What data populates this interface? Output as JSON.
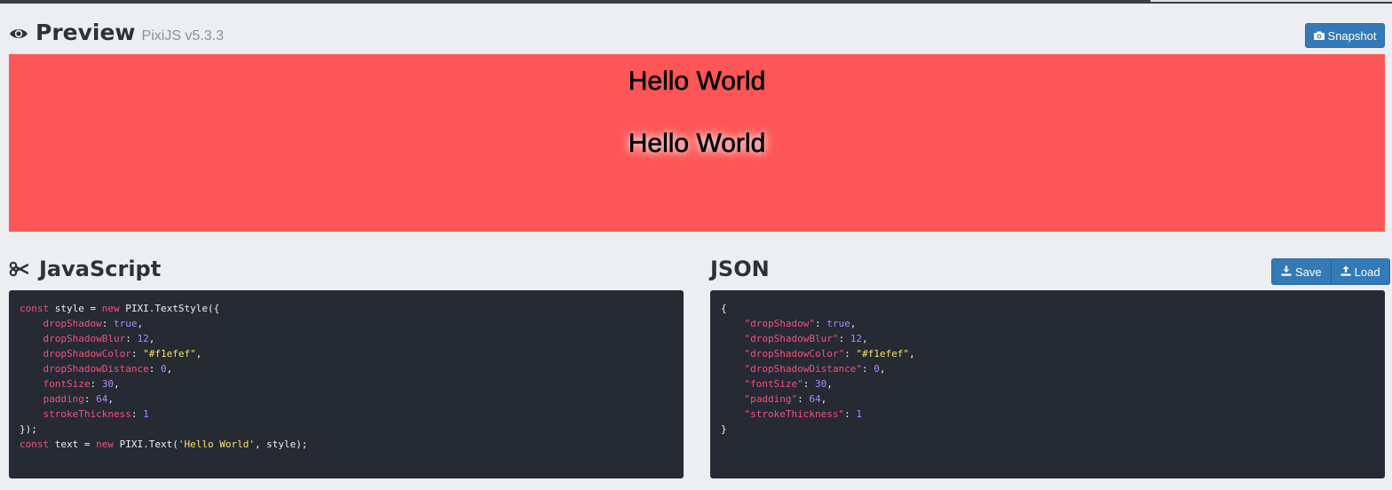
{
  "preview": {
    "title": "Preview",
    "subtitle": "PixiJS v5.3.3",
    "snapshot_label": "Snapshot",
    "canvas_bg": "#fe5656",
    "texts": [
      "Hello World",
      "Hello World"
    ]
  },
  "javascript": {
    "title": "JavaScript",
    "lines": [
      [
        [
          "kw",
          "const"
        ],
        [
          "plain",
          " style = "
        ],
        [
          "kw",
          "new"
        ],
        [
          "plain",
          " PIXI.TextStyle({"
        ]
      ],
      [
        [
          "plain",
          "    "
        ],
        [
          "prop",
          "dropShadow"
        ],
        [
          "plain",
          ": "
        ],
        [
          "bool",
          "true"
        ],
        [
          "plain",
          ","
        ]
      ],
      [
        [
          "plain",
          "    "
        ],
        [
          "prop",
          "dropShadowBlur"
        ],
        [
          "plain",
          ": "
        ],
        [
          "num",
          "12"
        ],
        [
          "plain",
          ","
        ]
      ],
      [
        [
          "plain",
          "    "
        ],
        [
          "prop",
          "dropShadowColor"
        ],
        [
          "plain",
          ": "
        ],
        [
          "str",
          "\"#f1efef\""
        ],
        [
          "plain",
          ","
        ]
      ],
      [
        [
          "plain",
          "    "
        ],
        [
          "prop",
          "dropShadowDistance"
        ],
        [
          "plain",
          ": "
        ],
        [
          "num",
          "0"
        ],
        [
          "plain",
          ","
        ]
      ],
      [
        [
          "plain",
          "    "
        ],
        [
          "prop",
          "fontSize"
        ],
        [
          "plain",
          ": "
        ],
        [
          "num",
          "30"
        ],
        [
          "plain",
          ","
        ]
      ],
      [
        [
          "plain",
          "    "
        ],
        [
          "prop",
          "padding"
        ],
        [
          "plain",
          ": "
        ],
        [
          "num",
          "64"
        ],
        [
          "plain",
          ","
        ]
      ],
      [
        [
          "plain",
          "    "
        ],
        [
          "prop",
          "strokeThickness"
        ],
        [
          "plain",
          ": "
        ],
        [
          "num",
          "1"
        ]
      ],
      [
        [
          "plain",
          "});"
        ]
      ],
      [
        [
          "kw",
          "const"
        ],
        [
          "plain",
          " text = "
        ],
        [
          "kw",
          "new"
        ],
        [
          "plain",
          " PIXI.Text("
        ],
        [
          "str",
          "'Hello World'"
        ],
        [
          "plain",
          ", style);"
        ]
      ]
    ]
  },
  "json": {
    "title": "JSON",
    "save_label": "Save",
    "load_label": "Load",
    "lines": [
      [
        [
          "plain",
          "{"
        ]
      ],
      [
        [
          "plain",
          "    "
        ],
        [
          "key",
          "\"dropShadow\""
        ],
        [
          "plain",
          ": "
        ],
        [
          "bool",
          "true"
        ],
        [
          "plain",
          ","
        ]
      ],
      [
        [
          "plain",
          "    "
        ],
        [
          "key",
          "\"dropShadowBlur\""
        ],
        [
          "plain",
          ": "
        ],
        [
          "num",
          "12"
        ],
        [
          "plain",
          ","
        ]
      ],
      [
        [
          "plain",
          "    "
        ],
        [
          "key",
          "\"dropShadowColor\""
        ],
        [
          "plain",
          ": "
        ],
        [
          "str",
          "\"#f1efef\""
        ],
        [
          "plain",
          ","
        ]
      ],
      [
        [
          "plain",
          "    "
        ],
        [
          "key",
          "\"dropShadowDistance\""
        ],
        [
          "plain",
          ": "
        ],
        [
          "num",
          "0"
        ],
        [
          "plain",
          ","
        ]
      ],
      [
        [
          "plain",
          "    "
        ],
        [
          "key",
          "\"fontSize\""
        ],
        [
          "plain",
          ": "
        ],
        [
          "num",
          "30"
        ],
        [
          "plain",
          ","
        ]
      ],
      [
        [
          "plain",
          "    "
        ],
        [
          "key",
          "\"padding\""
        ],
        [
          "plain",
          ": "
        ],
        [
          "num",
          "64"
        ],
        [
          "plain",
          ","
        ]
      ],
      [
        [
          "plain",
          "    "
        ],
        [
          "key",
          "\"strokeThickness\""
        ],
        [
          "plain",
          ": "
        ],
        [
          "num",
          "1"
        ]
      ],
      [
        [
          "plain",
          "}"
        ]
      ]
    ]
  },
  "colors": {
    "accent": "#337ab7",
    "editor_bg": "#262a33",
    "page_bg": "#eceef1"
  },
  "icons": {
    "preview": "eye-icon",
    "snapshot": "camera-icon",
    "javascript": "scissors-icon",
    "save": "download-icon",
    "load": "upload-icon"
  }
}
